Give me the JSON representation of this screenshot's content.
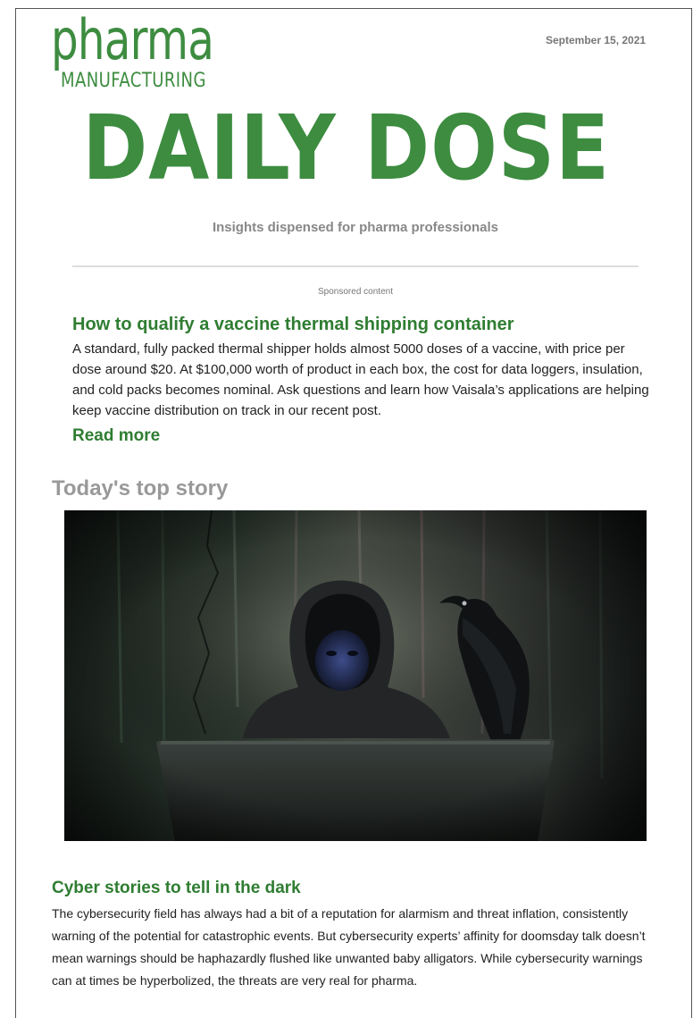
{
  "header": {
    "logo_word": "pharma",
    "logo_sub": "MANUFACTURING",
    "date": "September 15, 2021",
    "masthead": "DAILY DOSE",
    "tagline": "Insights dispensed for pharma professionals"
  },
  "sponsored": {
    "label": "Sponsored content",
    "title": "How to qualify a vaccine thermal shipping container",
    "body": "A standard, fully packed thermal shipper holds almost 5000 doses of a vaccine, with price per dose around $20. At $100,000 worth of product in each box, the cost for data loggers, insulation, and cold packs becomes nominal. Ask questions and learn how Vaisala’s applications are helping keep vaccine distribution on track in our recent post.",
    "cta": "Read more"
  },
  "top_story": {
    "section_label": "Today's top story",
    "title": "Cyber stories to tell in the dark",
    "body": "The cybersecurity field has always had a bit of a reputation for alarmism and threat inflation, consistently warning of the potential for catastrophic events. But cybersecurity experts’ affinity for doomsday talk doesn’t mean warnings should be haphazardly flushed like unwanted baby alligators. While cybersecurity warnings can at times be hyperbolized, the threats are very real for pharma."
  },
  "colors": {
    "brand_green": "#3d8c40",
    "link_green": "#2f7d32",
    "muted_gray": "#888888"
  }
}
